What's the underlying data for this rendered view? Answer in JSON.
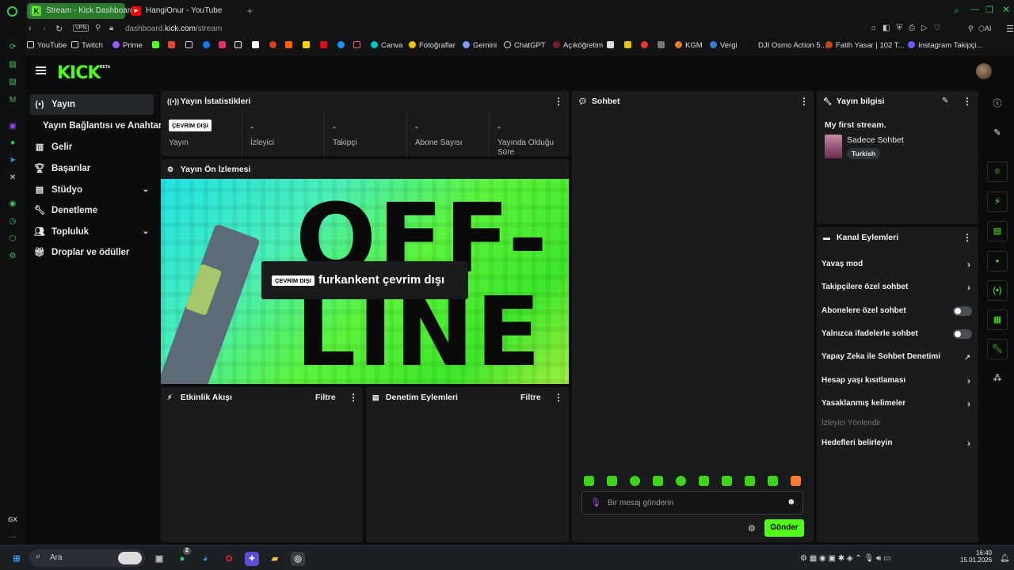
{
  "browser": {
    "tabs": [
      {
        "label": "Stream - Kick Dashboard",
        "active": true
      },
      {
        "label": "HangiOnur - YouTube",
        "active": false
      }
    ],
    "new_tab": "+",
    "vpn": "VPN",
    "url_prefix": "dashboard.",
    "url_domain": "kick.com",
    "url_path": "/stream",
    "ai_label": "AI",
    "bookmarks": [
      "YouTube",
      "Twitch",
      "Prime",
      "",
      "",
      "",
      "",
      "",
      "",
      "",
      "",
      "",
      "",
      "",
      "",
      "Canva",
      "Fotoğraflar",
      "Gemini",
      "ChatGPT",
      "Açıköğretim",
      "",
      "",
      "",
      "",
      "KGM",
      "Vergi",
      "DJI Osmo Action 5...",
      "Fatih Yasar | 102 T...",
      "Instagram Takipçi..."
    ]
  },
  "kick": {
    "logo": "KICK",
    "logo_beta": "BETA",
    "nav": [
      {
        "label": "Yayın",
        "icon": "stream-icon",
        "active": true
      },
      {
        "label": "Yayın Bağlantısı ve Anahtarı",
        "icon": "",
        "active": false
      },
      {
        "label": "Gelir",
        "icon": "chart-icon",
        "active": false
      },
      {
        "label": "Başarılar",
        "icon": "trophy-icon",
        "active": false
      },
      {
        "label": "Stüdyo",
        "icon": "studio-icon",
        "active": false
      },
      {
        "label": "Denetleme",
        "icon": "wrench-icon",
        "active": false
      },
      {
        "label": "Topluluk",
        "icon": "community-icon",
        "active": false
      },
      {
        "label": "Droplar ve ödüller",
        "icon": "gift-icon",
        "active": false
      }
    ],
    "stats": {
      "title": "Yayın İstatistikleri",
      "badge": "ÇEVRİM DIŞI",
      "items": [
        {
          "value": "",
          "label": "Yayın"
        },
        {
          "value": "-",
          "label": "İzleyici"
        },
        {
          "value": "-",
          "label": "Takipçi"
        },
        {
          "value": "-",
          "label": "Abone Sayısı"
        },
        {
          "value": "-",
          "label": "Yayında Olduğu Süre"
        }
      ]
    },
    "preview": {
      "title": "Yayın Ön İzlemesi",
      "badge": "ÇEVRİM DIŞI",
      "offline_text": "furkankent çevrim dışı",
      "big_text": "OFF-LINE"
    },
    "events": {
      "title": "Etkinlik Akışı",
      "filter": "Filtre"
    },
    "moderation": {
      "title": "Denetim Eylemleri",
      "filter": "Filtre"
    },
    "chat": {
      "title": "Sohbet",
      "placeholder": "Bir mesaj gönderin",
      "send": "Gönder"
    },
    "info": {
      "title": "Yayın bilgisi",
      "stream_title": "My first stream.",
      "category": "Sadece Sohbet",
      "tag": "Turkish"
    },
    "channel_actions": {
      "title": "Kanal Eylemleri",
      "items": [
        {
          "label": "Yavaş mod",
          "control": "arrow"
        },
        {
          "label": "Takipçilere özel sohbet",
          "control": "arrow"
        },
        {
          "label": "Abonelere özel sohbet",
          "control": "toggle"
        },
        {
          "label": "Yalnızca ifadelerle sohbet",
          "control": "toggle"
        },
        {
          "label": "Yapay Zeka ile Sohbet Denetimi",
          "control": "external"
        },
        {
          "label": "Hesap yaşı kısıtlaması",
          "control": "arrow"
        },
        {
          "label": "Yasaklanmış kelimeler",
          "control": "arrow"
        },
        {
          "label": "İzleyici Yönlendir",
          "control": "none"
        },
        {
          "label": "Hedefleri belirleyin",
          "control": "arrow"
        }
      ]
    }
  },
  "taskbar": {
    "search": "Ara",
    "whatsapp_badge": "2",
    "time": "16:40",
    "date": "15.01.2026"
  },
  "colors": {
    "accent": "#53fc18",
    "panel": "#191b1d",
    "bg": "#0b0c0d"
  }
}
